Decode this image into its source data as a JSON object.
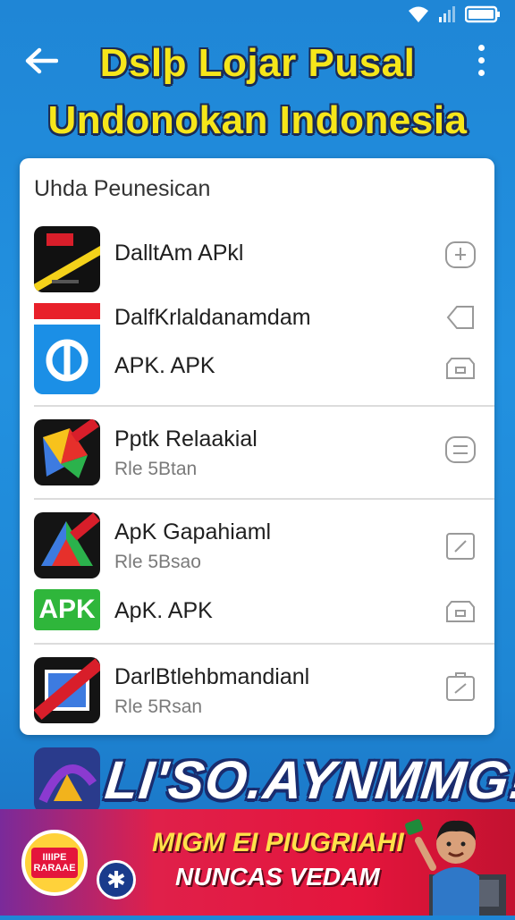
{
  "header": {
    "title_line1": "Dslþ Lojar Pusal",
    "title_line2": "Undonokan Indonesia"
  },
  "card": {
    "header": "Uhda Peunesican",
    "items": [
      {
        "name": "DalltAm APkl",
        "subtitle": ""
      },
      {
        "name": "DalfKrlaldanamdam",
        "subtitle": ""
      },
      {
        "name": "APK. APK",
        "subtitle": ""
      },
      {
        "name": "Pptk Relaakial",
        "subtitle": "Rle 5Btan"
      },
      {
        "name": "ApK Gapahiaml",
        "subtitle": "Rle 5Bsao"
      },
      {
        "name": "ApK. APK",
        "subtitle": "",
        "icon_text": "APK"
      },
      {
        "name": "DarlBtlehbmandianl",
        "subtitle": "Rle 5Rsan"
      }
    ]
  },
  "banner": {
    "title": "LI'SO.AYNMMG!",
    "line1": "MIGM EI PIUGRIAHI",
    "line2": "NUNCAS VEDAM",
    "badge_text": "IIIIPE RARAAE"
  },
  "colors": {
    "background": "#2291e0",
    "title_yellow": "#f6e61a",
    "banner_red": "#e4153c"
  },
  "icons": [
    "back-arrow-icon",
    "more-vert-icon",
    "wifi-icon",
    "signal-icon",
    "battery-icon"
  ]
}
